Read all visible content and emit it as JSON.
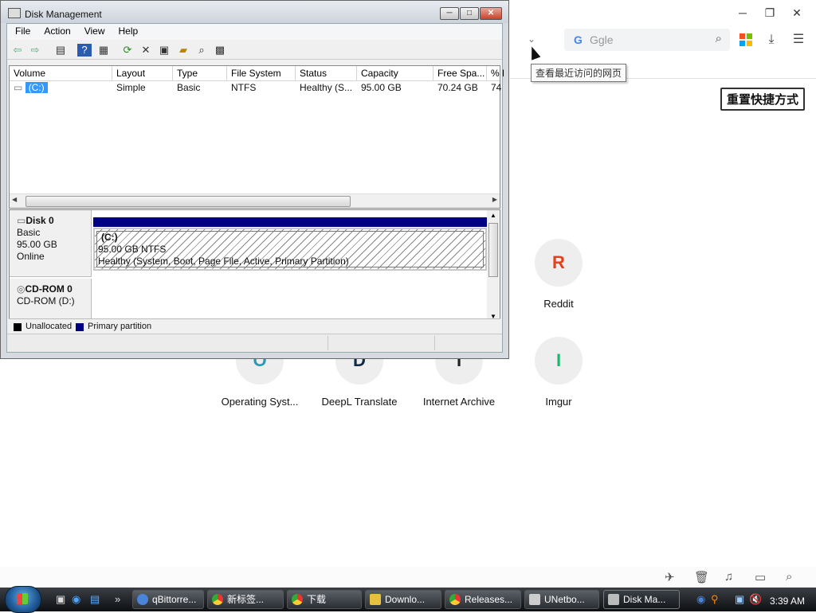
{
  "browser": {
    "search_engine_glyph": "G",
    "search_placeholder": "Ggle",
    "tooltip": "查看最近访问的网页",
    "reset_shortcuts_label": "重置快捷方式",
    "window_controls": {
      "minimize": "─",
      "restore": "❐",
      "close": "✕"
    },
    "tiles": [
      {
        "letter": "R",
        "label": "Reddit",
        "color": "#e2411c"
      },
      {
        "letter": "O",
        "label": "Operating Syst...",
        "color": "#2a9bb0"
      },
      {
        "letter": "D",
        "label": "DeepL Translate",
        "color": "#0f2b46"
      },
      {
        "letter": "I",
        "label": "Internet Archive",
        "color": "#222222"
      },
      {
        "letter": "I",
        "label": "Imgur",
        "color": "#1bb76e"
      }
    ]
  },
  "disk_mgmt": {
    "title": "Disk Management",
    "caption_buttons": {
      "minimize": "─",
      "maximize": "□",
      "close": "✕"
    },
    "menu": [
      "File",
      "Action",
      "View",
      "Help"
    ],
    "columns": [
      "Volume",
      "Layout",
      "Type",
      "File System",
      "Status",
      "Capacity",
      "Free Spa...",
      "% F"
    ],
    "rows": [
      {
        "volume": "(C:)",
        "layout": "Simple",
        "type": "Basic",
        "fs": "NTFS",
        "status": "Healthy (S...",
        "capacity": "95.00 GB",
        "free": "70.24 GB",
        "pct": "74"
      }
    ],
    "disks": [
      {
        "name": "Disk 0",
        "kind": "Basic",
        "size": "95.00 GB",
        "state": "Online"
      },
      {
        "name": "CD-ROM 0",
        "kind": "CD-ROM (D:)"
      }
    ],
    "partition": {
      "label": "(C:)",
      "size_fs": "95.00 GB NTFS",
      "status": "Healthy (System, Boot, Page File, Active, Primary Partition)"
    },
    "legend": [
      {
        "label": "Unallocated",
        "color": "#000000"
      },
      {
        "label": "Primary partition",
        "color": "#000080"
      }
    ]
  },
  "taskbar": {
    "items": [
      {
        "label": "qBittorre...",
        "color": "#4a84d8"
      },
      {
        "label": "新标签...",
        "color": "#e8a020"
      },
      {
        "label": "下载",
        "color": "#e8a020"
      },
      {
        "label": "Downlo...",
        "color": "#e8c040"
      },
      {
        "label": "Releases...",
        "color": "#e8a020"
      },
      {
        "label": "UNetbo...",
        "color": "#d0d0d0"
      },
      {
        "label": "Disk Ma...",
        "color": "#c0c0c0"
      }
    ],
    "clock": "3:39 AM",
    "overflow_glyph": "»"
  }
}
